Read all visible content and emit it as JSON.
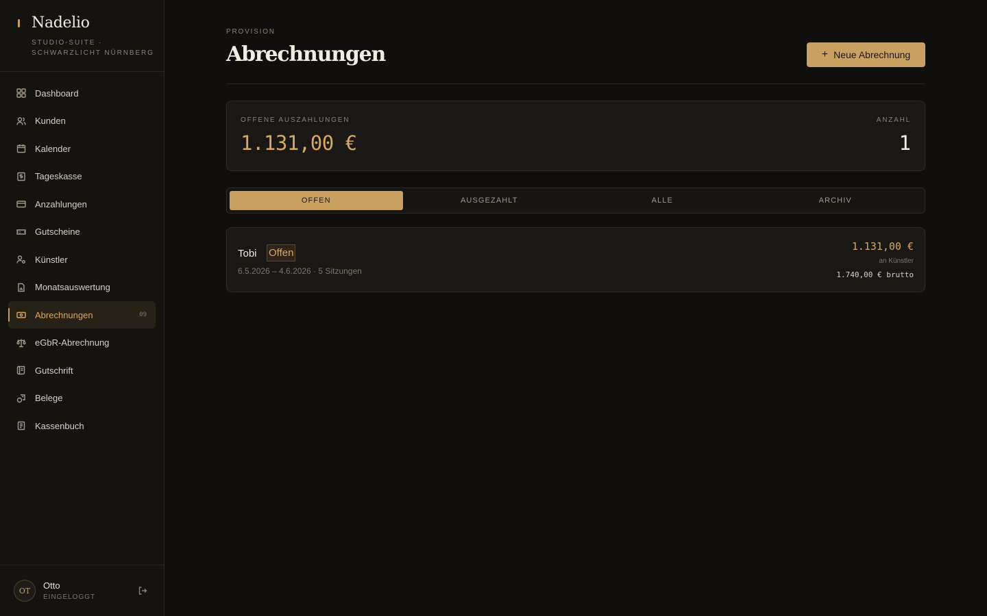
{
  "brand": {
    "name": "Nadelio",
    "subtitle": "STUDIO-SUITE · SCHWARZLICHT NÜRNBERG"
  },
  "sidebar": {
    "items": [
      {
        "label": "Dashboard",
        "icon": "dashboard-icon"
      },
      {
        "label": "Kunden",
        "icon": "users-icon"
      },
      {
        "label": "Kalender",
        "icon": "calendar-icon"
      },
      {
        "label": "Tageskasse",
        "icon": "cash-register-icon"
      },
      {
        "label": "Anzahlungen",
        "icon": "card-icon"
      },
      {
        "label": "Gutscheine",
        "icon": "ticket-icon"
      },
      {
        "label": "Künstler",
        "icon": "artist-icon"
      },
      {
        "label": "Monatsauswertung",
        "icon": "report-icon"
      },
      {
        "label": "Abrechnungen",
        "icon": "banknote-icon",
        "count": "09",
        "active": true
      },
      {
        "label": "eGbR-Abrechnung",
        "icon": "scale-icon"
      },
      {
        "label": "Gutschrift",
        "icon": "scroll-icon"
      },
      {
        "label": "Belege",
        "icon": "receipts-icon"
      },
      {
        "label": "Kassenbuch",
        "icon": "book-icon"
      }
    ]
  },
  "user": {
    "initials": "OT",
    "name": "Otto",
    "status": "EINGELOGGT"
  },
  "header": {
    "eyebrow": "PROVISION",
    "title": "Abrechnungen",
    "new_button": "Neue Abrechnung"
  },
  "summary": {
    "open_label": "OFFENE AUSZAHLUNGEN",
    "open_value": "1.131,00 €",
    "count_label": "ANZAHL",
    "count_value": "1"
  },
  "tabs": [
    {
      "label": "OFFEN",
      "active": true
    },
    {
      "label": "AUSGEZAHLT"
    },
    {
      "label": "ALLE"
    },
    {
      "label": "ARCHIV"
    }
  ],
  "settlements": [
    {
      "name": "Tobi",
      "status": "Offen",
      "meta": "6.5.2026 – 4.6.2026 · 5 Sitzungen",
      "amount": "1.131,00 €",
      "amount_note": "an Künstler",
      "brutto": "1.740,00 € brutto"
    }
  ],
  "colors": {
    "accent": "#caa061",
    "background": "#100f0d",
    "sidebar": "#141310"
  }
}
